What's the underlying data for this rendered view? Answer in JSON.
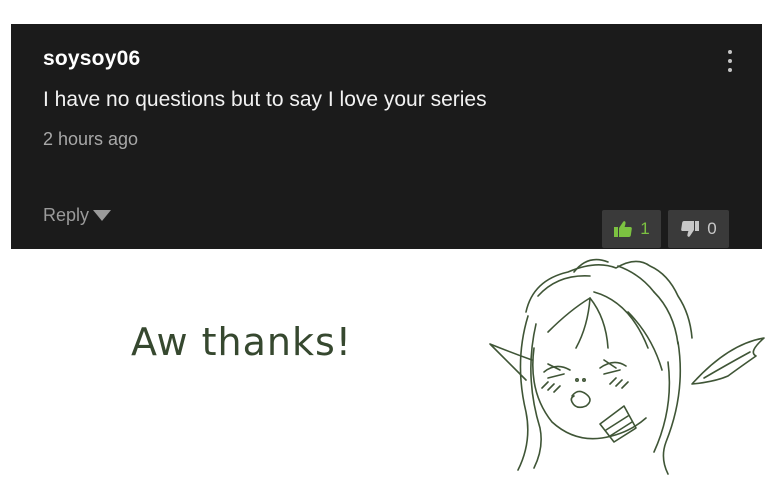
{
  "comment": {
    "username": "soysoy06",
    "text": "I have no questions but to say I love your series",
    "timestamp": "2 hours ago",
    "reply_label": "Reply",
    "likes": "1",
    "dislikes": "0",
    "menu_icon": "kebab-menu-icon",
    "like_icon": "thumbs-up-icon",
    "dislike_icon": "thumbs-down-icon"
  },
  "reply_caption": "Aw thanks!",
  "colors": {
    "card_background": "#1b1b1b",
    "like_green": "#7cc241",
    "caption_green": "#36482f",
    "sketch_line": "#3f5536"
  }
}
